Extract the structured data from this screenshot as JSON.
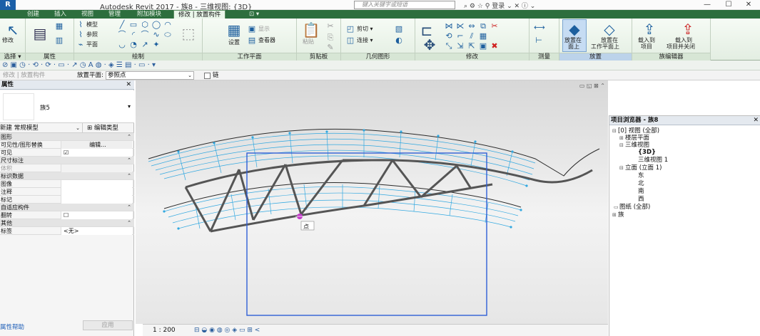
{
  "titlebar": {
    "logo": "R",
    "title": "Autodesk Revit 2017 -      族8 - 三维视图: {3D}",
    "search_placeholder": "键入关键字或短语",
    "icons_text": "⌕  ⚙  ☆  ⚲ 登录      ⌄  ✕  ⓘ ⌄",
    "minimize": "—",
    "maximize": "☐",
    "close": "✕"
  },
  "ribbon_tabs": [
    {
      "label": "创建"
    },
    {
      "label": "插入"
    },
    {
      "label": "视图"
    },
    {
      "label": "管理"
    },
    {
      "label": "附加模块"
    },
    {
      "label": "修改 | 放置构件",
      "active": true
    },
    {
      "label": "⊡ ▾"
    }
  ],
  "ribbon": {
    "modify_label": "修改",
    "select_label": "选择 ▾",
    "properties_label": "属性",
    "draw_label": "绘制",
    "draw_model": "模型",
    "draw_ref": "参照",
    "draw_plane": "平面",
    "workplane_label": "工作平面",
    "workplane_set": "设置",
    "workplane_show": "显示",
    "workplane_viewer": "查看器",
    "clipboard_label": "剪贴板",
    "clipboard_paste": "粘贴",
    "geometry_label": "几何图形",
    "geometry_cut": "剪切 ▾",
    "geometry_join": "连接 ▾",
    "modify_group_label": "修改",
    "measure_label": "测量",
    "placement_label": "放置",
    "place_on_face": "放置在",
    "place_on_face2": "面上",
    "place_on_workplane": "放置在",
    "place_on_workplane2": "工作平面上",
    "family_editor_label": "族编辑器",
    "load_into_project": "载入到",
    "load_into_project2": "项目",
    "load_and_close": "载入到",
    "load_and_close2": "项目并关闭"
  },
  "qat": {
    "icons": "⊘ ▣ ◷ · ⟲ · ⟳ · ▭ · ↗ ◷ A  ◍ · ◈ ☰  ▤ · ▭ · ▾"
  },
  "optbar": {
    "context": "修改 | 放置构件",
    "placement_plane_label": "放置平面:",
    "placement_plane_value": "参照点",
    "chain_label": "链"
  },
  "properties": {
    "title": "属性",
    "close": "✕",
    "type_name": "族5",
    "filter_value": "新建 常规模型",
    "edit_type": "编辑类型",
    "rows": [
      {
        "label": "图形",
        "value": "",
        "category": true
      },
      {
        "label": "可见性/图形替换",
        "value": "编辑..."
      },
      {
        "label": "可见",
        "value": "☑"
      },
      {
        "label": "尺寸标注",
        "value": "",
        "category": true
      },
      {
        "label": "体积",
        "value": ""
      },
      {
        "label": "标识数据",
        "value": "",
        "category": true
      },
      {
        "label": "图像",
        "value": ""
      },
      {
        "label": "注释",
        "value": ""
      },
      {
        "label": "标记",
        "value": ""
      },
      {
        "label": "自适应构件",
        "value": "",
        "category": true
      },
      {
        "label": "翻转",
        "value": "☐"
      },
      {
        "label": "其他",
        "value": "",
        "category": true
      },
      {
        "label": "标签",
        "value": "<无>"
      }
    ],
    "help_link": "属性帮助",
    "apply_button": "应用"
  },
  "viewport": {
    "tooltip": "点",
    "tools": "▭ ◱ ⊠ ⌃"
  },
  "view_control": {
    "scale": "1 : 200",
    "icons": "⊟  ◒  ◉  ◍  ◎  ◈  ▭  ⊞  <"
  },
  "project_browser": {
    "title": "项目浏览器 - 族8",
    "close": "✕",
    "nodes": [
      {
        "text": "[0] 视图 (全部)",
        "toggle": "⊟",
        "level": 0
      },
      {
        "text": "楼层平面",
        "toggle": "⊞",
        "level": 1
      },
      {
        "text": "三维视图",
        "toggle": "⊟",
        "level": 1
      },
      {
        "text": "{3D}",
        "toggle": "",
        "level": 2,
        "bold": true
      },
      {
        "text": "三维视图 1",
        "toggle": "",
        "level": 2
      },
      {
        "text": "立面 (立面 1)",
        "toggle": "⊟",
        "level": 1
      },
      {
        "text": "东",
        "toggle": "",
        "level": 2
      },
      {
        "text": "北",
        "toggle": "",
        "level": 2
      },
      {
        "text": "南",
        "toggle": "",
        "level": 2
      },
      {
        "text": "西",
        "toggle": "",
        "level": 2
      },
      {
        "text": "图纸 (全部)",
        "toggle": "",
        "level": 0
      },
      {
        "text": "族",
        "toggle": "⊞",
        "level": 0
      }
    ]
  },
  "colors": {
    "ribbon_tab_bg": "#2d6e3e",
    "selection_blue": "#2f5fd6",
    "point_magenta": "#c23ac9",
    "grid_cyan": "#32a8e0"
  }
}
